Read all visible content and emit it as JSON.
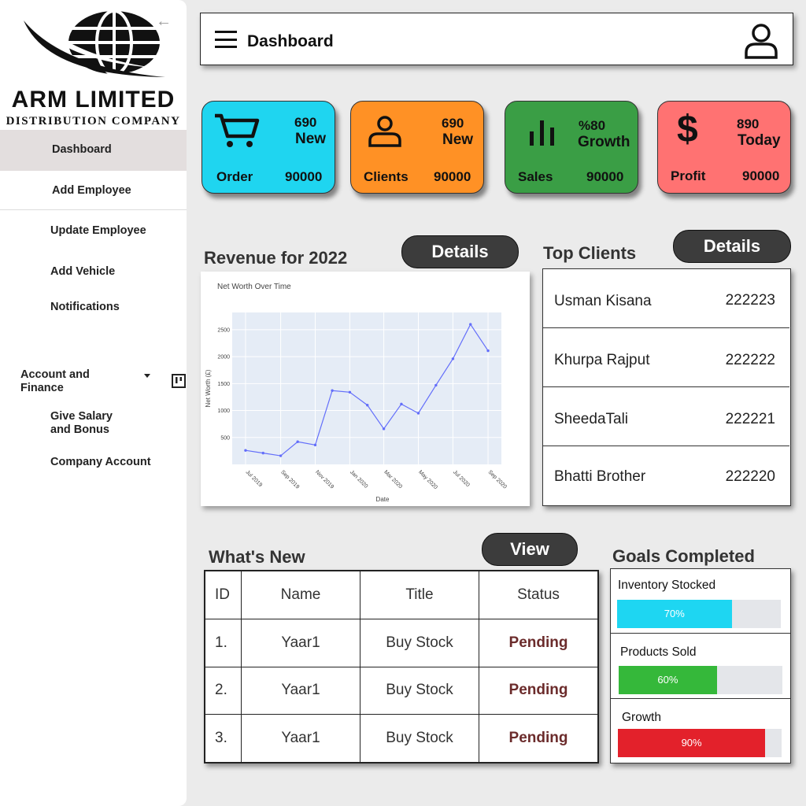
{
  "brand": {
    "name": "ARM LIMITED",
    "tagline": "DISTRIBUTION COMPANY"
  },
  "sidebar": {
    "items": [
      {
        "label": "Dashboard"
      },
      {
        "label": "Add Employee"
      },
      {
        "label": "Update Employee"
      },
      {
        "label": "Add Vehicle"
      },
      {
        "label": "Notifications"
      }
    ],
    "section": {
      "label": "Account and Finance"
    },
    "sub_items": [
      {
        "label": "Give Salary and Bonus"
      },
      {
        "label": "Company Account"
      }
    ]
  },
  "header": {
    "title": "Dashboard"
  },
  "stats": [
    {
      "top": "690",
      "sub": "New",
      "label": "Order",
      "value": "90000",
      "color": "#1fd5f0",
      "icon": "cart-icon"
    },
    {
      "top": "690",
      "sub": "New",
      "label": "Clients",
      "value": "90000",
      "color": "#ff9125",
      "icon": "user-icon"
    },
    {
      "top": "%80",
      "sub": "Growth",
      "label": "Sales",
      "value": "90000",
      "color": "#3a9e45",
      "icon": "bar-chart-icon"
    },
    {
      "top": "890",
      "sub": "Today",
      "label": "Profit",
      "value": "90000",
      "color": "#ff7272",
      "icon": "dollar-icon"
    }
  ],
  "revenue": {
    "title": "Revenue for 2022",
    "details_label": "Details"
  },
  "chart_data": {
    "type": "line",
    "title": "Net Worth Over Time",
    "xlabel": "Date",
    "ylabel": "Net Worth (£)",
    "x": [
      "2019-07-01",
      "2019-08-01",
      "2019-09-01",
      "2019-10-01",
      "2019-11-01",
      "2019-12-01",
      "2020-01-01",
      "2020-02-01",
      "2020-03-01",
      "2020-04-01",
      "2020-05-01",
      "2020-06-01",
      "2020-07-01",
      "2020-08-01",
      "2020-09-01"
    ],
    "values": [
      260,
      210,
      160,
      420,
      360,
      1370,
      1340,
      1100,
      660,
      1120,
      950,
      1470,
      1960,
      2600,
      2110
    ],
    "xticks": [
      "Jul 2019",
      "Sep 2019",
      "Nov 2019",
      "Jan 2020",
      "Mar 2020",
      "May 2020",
      "Jul 2020",
      "Sep 2020"
    ],
    "yticks": [
      500,
      1000,
      1500,
      2000,
      2500
    ],
    "ylim": [
      0,
      2820
    ],
    "grid": true,
    "line_color": "#636efa",
    "plot_bg": "#e5ecf6"
  },
  "top_clients": {
    "title": "Top Clients",
    "details_label": "Details",
    "rows": [
      {
        "name": "Usman Kisana",
        "value": "222223"
      },
      {
        "name": "Khurpa Rajput",
        "value": "222222"
      },
      {
        "name": "SheedaTali",
        "value": "222221"
      },
      {
        "name": "Bhatti Brother",
        "value": "222220"
      }
    ]
  },
  "whats_new": {
    "title": "What's New",
    "view_label": "View",
    "headers": [
      "ID",
      "Name",
      "Title",
      "Status"
    ],
    "rows": [
      [
        "1.",
        "Yaar1",
        "Buy Stock",
        "Pending"
      ],
      [
        "2.",
        "Yaar1",
        "Buy Stock",
        "Pending"
      ],
      [
        "3.",
        "Yaar1",
        "Buy Stock",
        "Pending"
      ]
    ]
  },
  "goals": {
    "title": "Goals Completed",
    "items": [
      {
        "label": "Inventory Stocked",
        "percent": 70,
        "text": "70%",
        "color": "#1ed6f2"
      },
      {
        "label": "Products Sold",
        "percent": 60,
        "text": "60%",
        "color": "#35b83a"
      },
      {
        "label": "Growth",
        "percent": 90,
        "text": "90%",
        "color": "#e3212b"
      }
    ]
  }
}
